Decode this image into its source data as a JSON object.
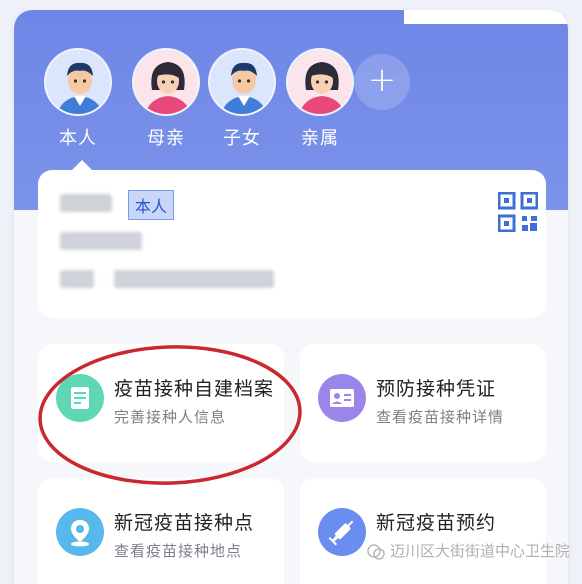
{
  "members": [
    {
      "label": "本人",
      "icon": "male-avatar-icon"
    },
    {
      "label": "母亲",
      "icon": "female-avatar-icon"
    },
    {
      "label": "子女",
      "icon": "male-avatar-icon"
    },
    {
      "label": "亲属",
      "icon": "female-avatar-icon"
    }
  ],
  "add_member": "+",
  "info_card": {
    "relation_tag": "本人",
    "qr_icon": "qr-code-icon"
  },
  "tiles": [
    {
      "title": "疫苗接种自建档案",
      "subtitle": "完善接种人信息",
      "icon": "document-edit-icon",
      "color": "#5fd6b4"
    },
    {
      "title": "预防接种凭证",
      "subtitle": "查看疫苗接种详情",
      "icon": "id-card-icon",
      "color": "#9a86e8"
    },
    {
      "title": "新冠疫苗接种点",
      "subtitle": "查看疫苗接种地点",
      "icon": "map-pin-icon",
      "color": "#58b8ec"
    },
    {
      "title": "新冠疫苗预约",
      "subtitle": "",
      "icon": "syringe-icon",
      "color": "#6a8ef0"
    }
  ],
  "colors": {
    "header": "#7088e6",
    "highlight_circle": "#c9282e"
  },
  "watermark": "迈川区大街街道中心卫生院"
}
